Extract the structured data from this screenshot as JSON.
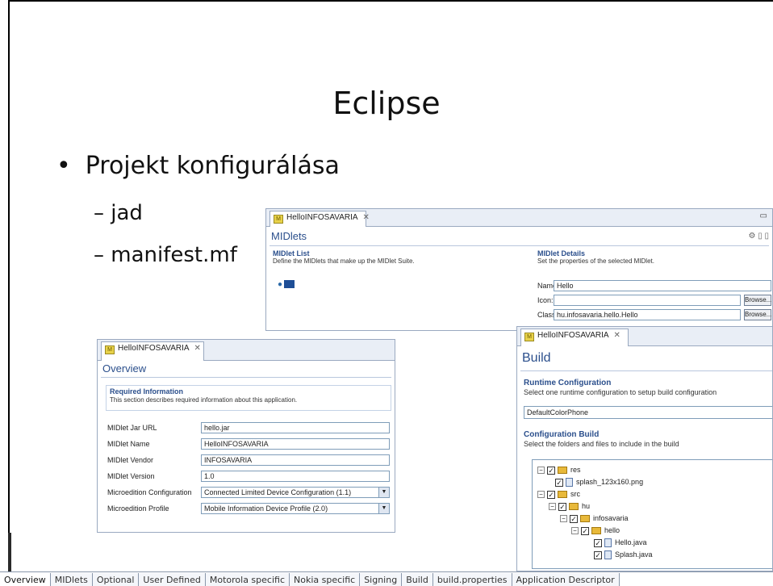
{
  "slide": {
    "title": "Eclipse",
    "bullet": "Projekt konfigurálása",
    "sub_items": [
      "– jad",
      "– manifest.mf"
    ]
  },
  "midlets_panel": {
    "tab_label": "HelloINFOSAVARIA",
    "title": "MIDlets",
    "list_section": {
      "heading": "MIDlet List",
      "description": "Define the MIDlets that make up the MIDlet Suite."
    },
    "details_section": {
      "heading": "MIDlet Details",
      "description": "Set the properties of the selected MIDlet."
    },
    "name_label": "Name:",
    "name_value": "Hello",
    "icon_label": "Icon:",
    "icon_value": "",
    "class_label": "Class:",
    "class_value": "hu.infosavaria.hello.Hello",
    "browse_label": "Browse..."
  },
  "overview_panel": {
    "tab_label": "HelloINFOSAVARIA",
    "title": "Overview",
    "section_heading": "Required Information",
    "section_description": "This section describes required information about this application.",
    "fields": [
      {
        "label": "MIDlet Jar URL",
        "value": "hello.jar"
      },
      {
        "label": "MIDlet Name",
        "value": "HelloINFOSAVARIA"
      },
      {
        "label": "MIDlet Vendor",
        "value": "INFOSAVARIA"
      },
      {
        "label": "MIDlet Version",
        "value": "1.0"
      },
      {
        "label": "Microedition Configuration",
        "value": "Connected Limited Device Configuration (1.1)"
      },
      {
        "label": "Microedition Profile",
        "value": "Mobile Information Device Profile (2.0)"
      }
    ]
  },
  "build_panel": {
    "tab_label": "HelloINFOSAVARIA",
    "title": "Build",
    "runtime_heading": "Runtime Configuration",
    "runtime_description": "Select one runtime configuration to setup build configuration",
    "runtime_value": "DefaultColorPhone",
    "config_heading": "Configuration Build",
    "config_description": "Select the folders and files to include in the build",
    "tree": [
      "res",
      "splash_123x160.png",
      "src",
      "hu",
      "infosavaria",
      "hello",
      "Hello.java",
      "Splash.java"
    ]
  },
  "bottom_tabs": [
    "Overview",
    "MIDlets",
    "Optional",
    "User Defined",
    "Motorola specific",
    "Nokia specific",
    "Signing",
    "Build",
    "build.properties",
    "Application Descriptor"
  ]
}
